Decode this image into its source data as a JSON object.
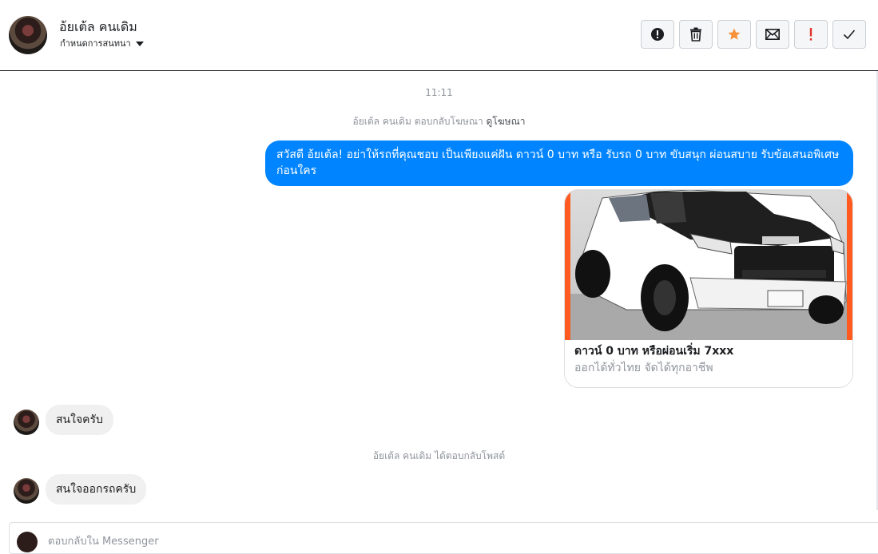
{
  "header": {
    "name": "อ้ยเต้ล คนเดิม",
    "subtitle": "กำหนดการสนทนา",
    "buttons": [
      {
        "id": "alert",
        "icon": "alert-circle-icon"
      },
      {
        "id": "delete",
        "icon": "trash-icon"
      },
      {
        "id": "star",
        "icon": "star-icon",
        "color": "#f7923b"
      },
      {
        "id": "mail",
        "icon": "envelope-icon"
      },
      {
        "id": "spam",
        "icon": "exclamation-icon",
        "color": "#e0362c"
      },
      {
        "id": "done",
        "icon": "checkmark-icon"
      }
    ]
  },
  "thread": {
    "timestamp": "11:11",
    "ad_reply_text": "อ้ยเต้ล คนเดิม ตอบกลับโฆษณา",
    "ad_reply_link": "ดูโฆษณา",
    "outgoing_message": "สวัสดี อ้ยเต้ล! อย่าให้รถที่คุณชอบ เป็นเพียงแค่ฝัน ดาวน์ 0 บาท หรือ รับรถ 0 บาท ขับสนุก ผ่อนสบาย รับข้อเสนอพิเศษก่อนใคร",
    "ad_card": {
      "title": "ดาวน์ 0 บาท หรือผ่อนเริ่ม 7xxx",
      "subtitle": "ออกได้ทั่วไทย จัดได้ทุกอาชีพ",
      "accent_color": "#ff5a1f"
    },
    "incoming_1": "สนใจครับ",
    "post_reply_text": "อ้ยเต้ล คนเดิม ได้ตอบกลับโพสต์",
    "incoming_2": "สนใจออกรถครับ"
  },
  "composer": {
    "placeholder": "ตอบกลับใน Messenger"
  },
  "colors": {
    "outgoing_bubble": "#0084ff",
    "incoming_bubble": "#f1f0f0"
  }
}
